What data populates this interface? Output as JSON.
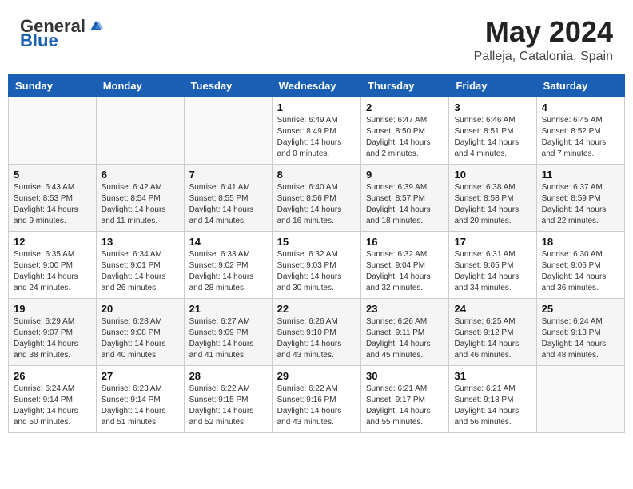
{
  "header": {
    "logo_general": "General",
    "logo_blue": "Blue",
    "month_title": "May 2024",
    "location": "Palleja, Catalonia, Spain"
  },
  "days_of_week": [
    "Sunday",
    "Monday",
    "Tuesday",
    "Wednesday",
    "Thursday",
    "Friday",
    "Saturday"
  ],
  "weeks": [
    [
      {
        "day": "",
        "info": ""
      },
      {
        "day": "",
        "info": ""
      },
      {
        "day": "",
        "info": ""
      },
      {
        "day": "1",
        "info": "Sunrise: 6:49 AM\nSunset: 8:49 PM\nDaylight: 14 hours\nand 0 minutes."
      },
      {
        "day": "2",
        "info": "Sunrise: 6:47 AM\nSunset: 8:50 PM\nDaylight: 14 hours\nand 2 minutes."
      },
      {
        "day": "3",
        "info": "Sunrise: 6:46 AM\nSunset: 8:51 PM\nDaylight: 14 hours\nand 4 minutes."
      },
      {
        "day": "4",
        "info": "Sunrise: 6:45 AM\nSunset: 8:52 PM\nDaylight: 14 hours\nand 7 minutes."
      }
    ],
    [
      {
        "day": "5",
        "info": "Sunrise: 6:43 AM\nSunset: 8:53 PM\nDaylight: 14 hours\nand 9 minutes."
      },
      {
        "day": "6",
        "info": "Sunrise: 6:42 AM\nSunset: 8:54 PM\nDaylight: 14 hours\nand 11 minutes."
      },
      {
        "day": "7",
        "info": "Sunrise: 6:41 AM\nSunset: 8:55 PM\nDaylight: 14 hours\nand 14 minutes."
      },
      {
        "day": "8",
        "info": "Sunrise: 6:40 AM\nSunset: 8:56 PM\nDaylight: 14 hours\nand 16 minutes."
      },
      {
        "day": "9",
        "info": "Sunrise: 6:39 AM\nSunset: 8:57 PM\nDaylight: 14 hours\nand 18 minutes."
      },
      {
        "day": "10",
        "info": "Sunrise: 6:38 AM\nSunset: 8:58 PM\nDaylight: 14 hours\nand 20 minutes."
      },
      {
        "day": "11",
        "info": "Sunrise: 6:37 AM\nSunset: 8:59 PM\nDaylight: 14 hours\nand 22 minutes."
      }
    ],
    [
      {
        "day": "12",
        "info": "Sunrise: 6:35 AM\nSunset: 9:00 PM\nDaylight: 14 hours\nand 24 minutes."
      },
      {
        "day": "13",
        "info": "Sunrise: 6:34 AM\nSunset: 9:01 PM\nDaylight: 14 hours\nand 26 minutes."
      },
      {
        "day": "14",
        "info": "Sunrise: 6:33 AM\nSunset: 9:02 PM\nDaylight: 14 hours\nand 28 minutes."
      },
      {
        "day": "15",
        "info": "Sunrise: 6:32 AM\nSunset: 9:03 PM\nDaylight: 14 hours\nand 30 minutes."
      },
      {
        "day": "16",
        "info": "Sunrise: 6:32 AM\nSunset: 9:04 PM\nDaylight: 14 hours\nand 32 minutes."
      },
      {
        "day": "17",
        "info": "Sunrise: 6:31 AM\nSunset: 9:05 PM\nDaylight: 14 hours\nand 34 minutes."
      },
      {
        "day": "18",
        "info": "Sunrise: 6:30 AM\nSunset: 9:06 PM\nDaylight: 14 hours\nand 36 minutes."
      }
    ],
    [
      {
        "day": "19",
        "info": "Sunrise: 6:29 AM\nSunset: 9:07 PM\nDaylight: 14 hours\nand 38 minutes."
      },
      {
        "day": "20",
        "info": "Sunrise: 6:28 AM\nSunset: 9:08 PM\nDaylight: 14 hours\nand 40 minutes."
      },
      {
        "day": "21",
        "info": "Sunrise: 6:27 AM\nSunset: 9:09 PM\nDaylight: 14 hours\nand 41 minutes."
      },
      {
        "day": "22",
        "info": "Sunrise: 6:26 AM\nSunset: 9:10 PM\nDaylight: 14 hours\nand 43 minutes."
      },
      {
        "day": "23",
        "info": "Sunrise: 6:26 AM\nSunset: 9:11 PM\nDaylight: 14 hours\nand 45 minutes."
      },
      {
        "day": "24",
        "info": "Sunrise: 6:25 AM\nSunset: 9:12 PM\nDaylight: 14 hours\nand 46 minutes."
      },
      {
        "day": "25",
        "info": "Sunrise: 6:24 AM\nSunset: 9:13 PM\nDaylight: 14 hours\nand 48 minutes."
      }
    ],
    [
      {
        "day": "26",
        "info": "Sunrise: 6:24 AM\nSunset: 9:14 PM\nDaylight: 14 hours\nand 50 minutes."
      },
      {
        "day": "27",
        "info": "Sunrise: 6:23 AM\nSunset: 9:14 PM\nDaylight: 14 hours\nand 51 minutes."
      },
      {
        "day": "28",
        "info": "Sunrise: 6:22 AM\nSunset: 9:15 PM\nDaylight: 14 hours\nand 52 minutes."
      },
      {
        "day": "29",
        "info": "Sunrise: 6:22 AM\nSunset: 9:16 PM\nDaylight: 14 hours\nand 43 minutes."
      },
      {
        "day": "30",
        "info": "Sunrise: 6:21 AM\nSunset: 9:17 PM\nDaylight: 14 hours\nand 55 minutes."
      },
      {
        "day": "31",
        "info": "Sunrise: 6:21 AM\nSunset: 9:18 PM\nDaylight: 14 hours\nand 56 minutes."
      },
      {
        "day": "",
        "info": ""
      }
    ]
  ]
}
